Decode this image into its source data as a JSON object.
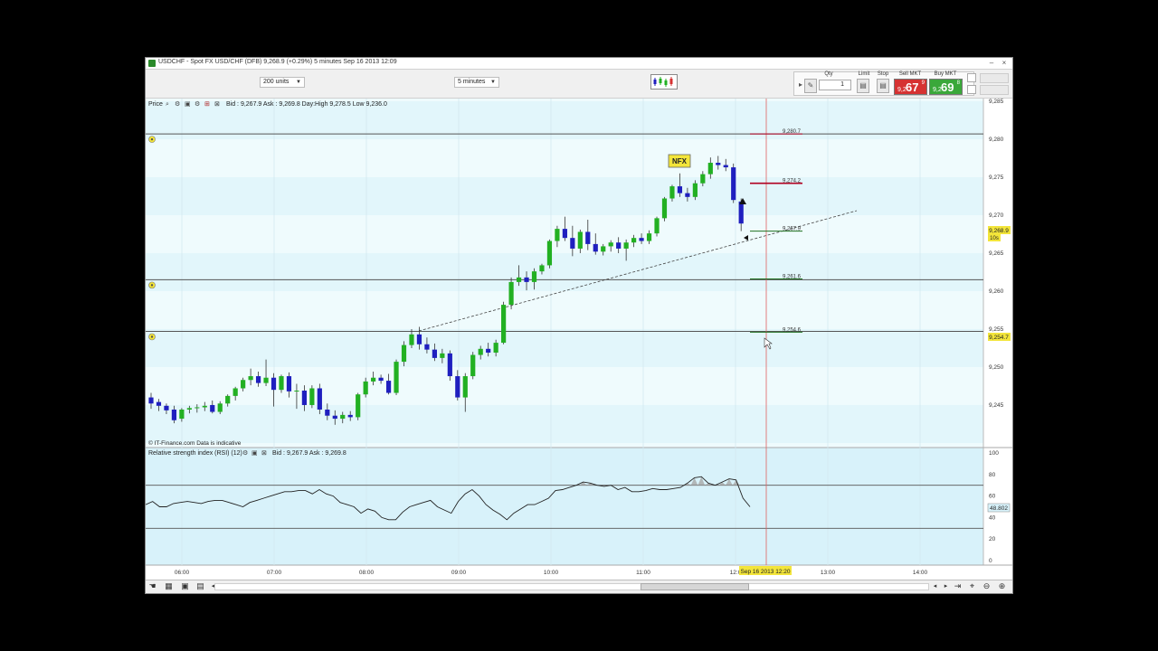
{
  "window": {
    "title": "USDCHF - Spot FX USD/CHF (DFB)   9,268.9 (+0.29%)    5 minutes   Sep 16 2013 12:09"
  },
  "toolbar": {
    "size_select": "200 units",
    "interval_select": "5 minutes",
    "qty_label": "Qty",
    "qty_value": "1",
    "limit_label": "Limit",
    "stop_label": "Stop",
    "sell_label": "Sell MKT",
    "sell_prefix": "9,2",
    "sell_big": "67",
    "sell_sup": "9",
    "buy_label": "Buy MKT",
    "buy_prefix": "9,2",
    "buy_big": "69",
    "buy_sup": "8",
    "sell_color": "#d63232",
    "buy_color": "#3aa83a"
  },
  "price_panel": {
    "label": "Price",
    "info": "Bid : 9,267.9  Ask : 9,269.8  Day:High 9,278.5  Low 9,236.0",
    "watermark": "© IT-Finance.com  Data is indicative",
    "nfx_label": "NFX",
    "level_labels": [
      "9,280.7",
      "9,274.2",
      "9,267.9",
      "9,261.6",
      "9,254.6"
    ],
    "current_price_tag": "9,268.9",
    "countdown_tag": "10s",
    "hline_tag": "9,254.7",
    "y_ticks": [
      "9,285",
      "9,280",
      "9,275",
      "9,270",
      "9,265",
      "9,260",
      "9,255",
      "9,250",
      "9,245"
    ]
  },
  "rsi_panel": {
    "label": "Relative strength index (RSI) (12)",
    "info": "Bid : 9,267.9  Ask : 9,269.8",
    "y_ticks": [
      "100",
      "80",
      "60",
      "40",
      "20",
      "0"
    ],
    "current_value": "48.802"
  },
  "x_axis": {
    "ticks": [
      "06:00",
      "07:00",
      "08:00",
      "09:00",
      "10:00",
      "11:00",
      "12:0",
      "13:00",
      "14:00"
    ],
    "cursor_label": "Sep 16 2013 12:20"
  },
  "colors": {
    "bull": "#22b022",
    "bear": "#1f1fbf",
    "chart_bg": "#effbfd",
    "chart_bg_alt": "#e2f6fb",
    "rsi_bg": "#d8f2fa",
    "cursor_line": "#e06060",
    "level_red": "#b00020",
    "level_green": "#207020",
    "tag_yellow": "#f3e53a"
  },
  "icons": [
    "magnifier-icon",
    "settings-icon",
    "lock-icon",
    "close-icon",
    "zoom-in-icon",
    "zoom-out-icon",
    "scroll-left-icon",
    "scroll-right-icon"
  ]
}
